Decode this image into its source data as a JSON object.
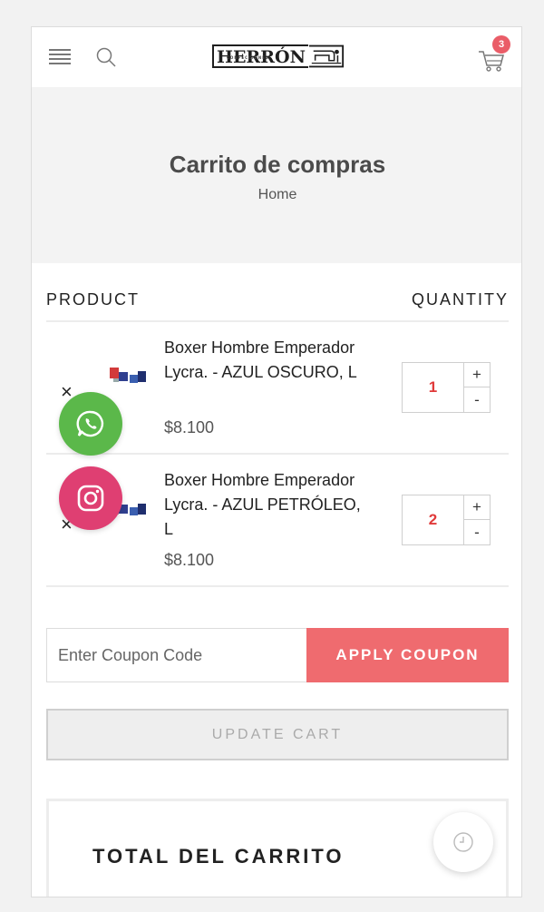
{
  "header": {
    "logo_text": "HERRÓN",
    "logo_subtext": "CONFECCIONES",
    "cart_count": "3"
  },
  "hero": {
    "title": "Carrito de compras",
    "breadcrumb": "Home"
  },
  "cart": {
    "col_product": "PRODUCT",
    "col_quantity": "QUANTITY",
    "remove_symbol": "×",
    "items": [
      {
        "name": "Boxer Hombre Emperador Lycra. - AZUL OSCURO, L",
        "price": "$8.100",
        "quantity": "1"
      },
      {
        "name": "Boxer Hombre Emperador Lycra. - AZUL PETRÓLEO, L",
        "price": "$8.100",
        "quantity": "2"
      }
    ],
    "plus_label": "+",
    "minus_label": "-"
  },
  "coupon": {
    "placeholder": "Enter Coupon Code",
    "apply_label": "APPLY COUPON"
  },
  "update_label": "UPDATE CART",
  "totals": {
    "title": "TOTAL DEL CARRITO"
  },
  "colors": {
    "accent": "#ef6b6f",
    "whatsapp": "#5bb84a",
    "instagram": "#df3f72",
    "qty_text": "#e03a3a"
  }
}
